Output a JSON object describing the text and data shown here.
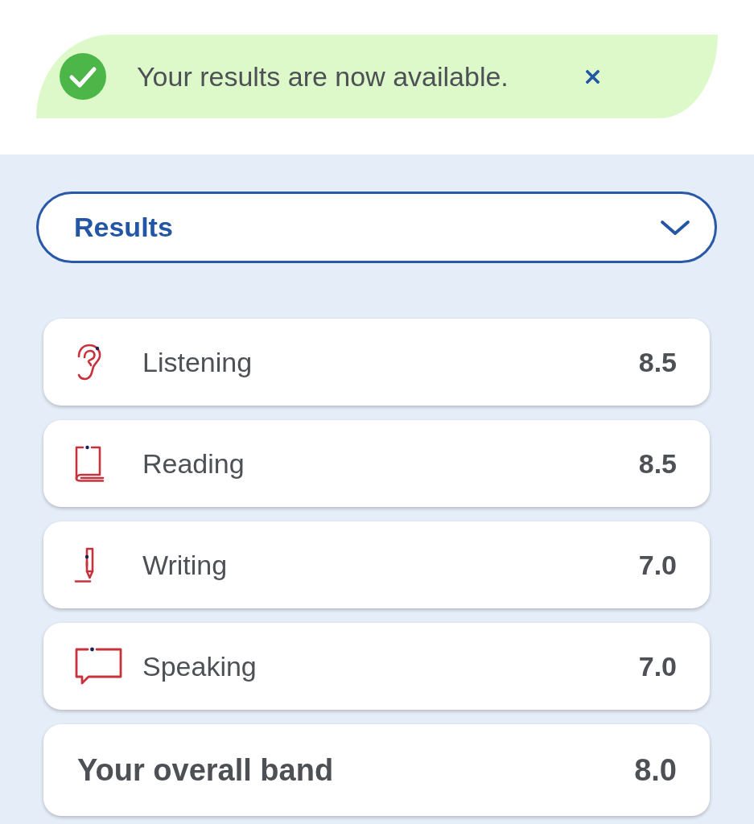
{
  "notification": {
    "message": "Your results are now available."
  },
  "dropdown": {
    "label": "Results",
    "expanded": false
  },
  "scores": [
    {
      "kind": "ear",
      "label": "Listening",
      "score": "8.5"
    },
    {
      "kind": "book",
      "label": "Reading",
      "score": "8.5"
    },
    {
      "kind": "pen",
      "label": "Writing",
      "score": "7.0"
    },
    {
      "kind": "speech",
      "label": "Speaking",
      "score": "7.0"
    }
  ],
  "overall": {
    "label": "Your overall band",
    "score": "8.0"
  }
}
